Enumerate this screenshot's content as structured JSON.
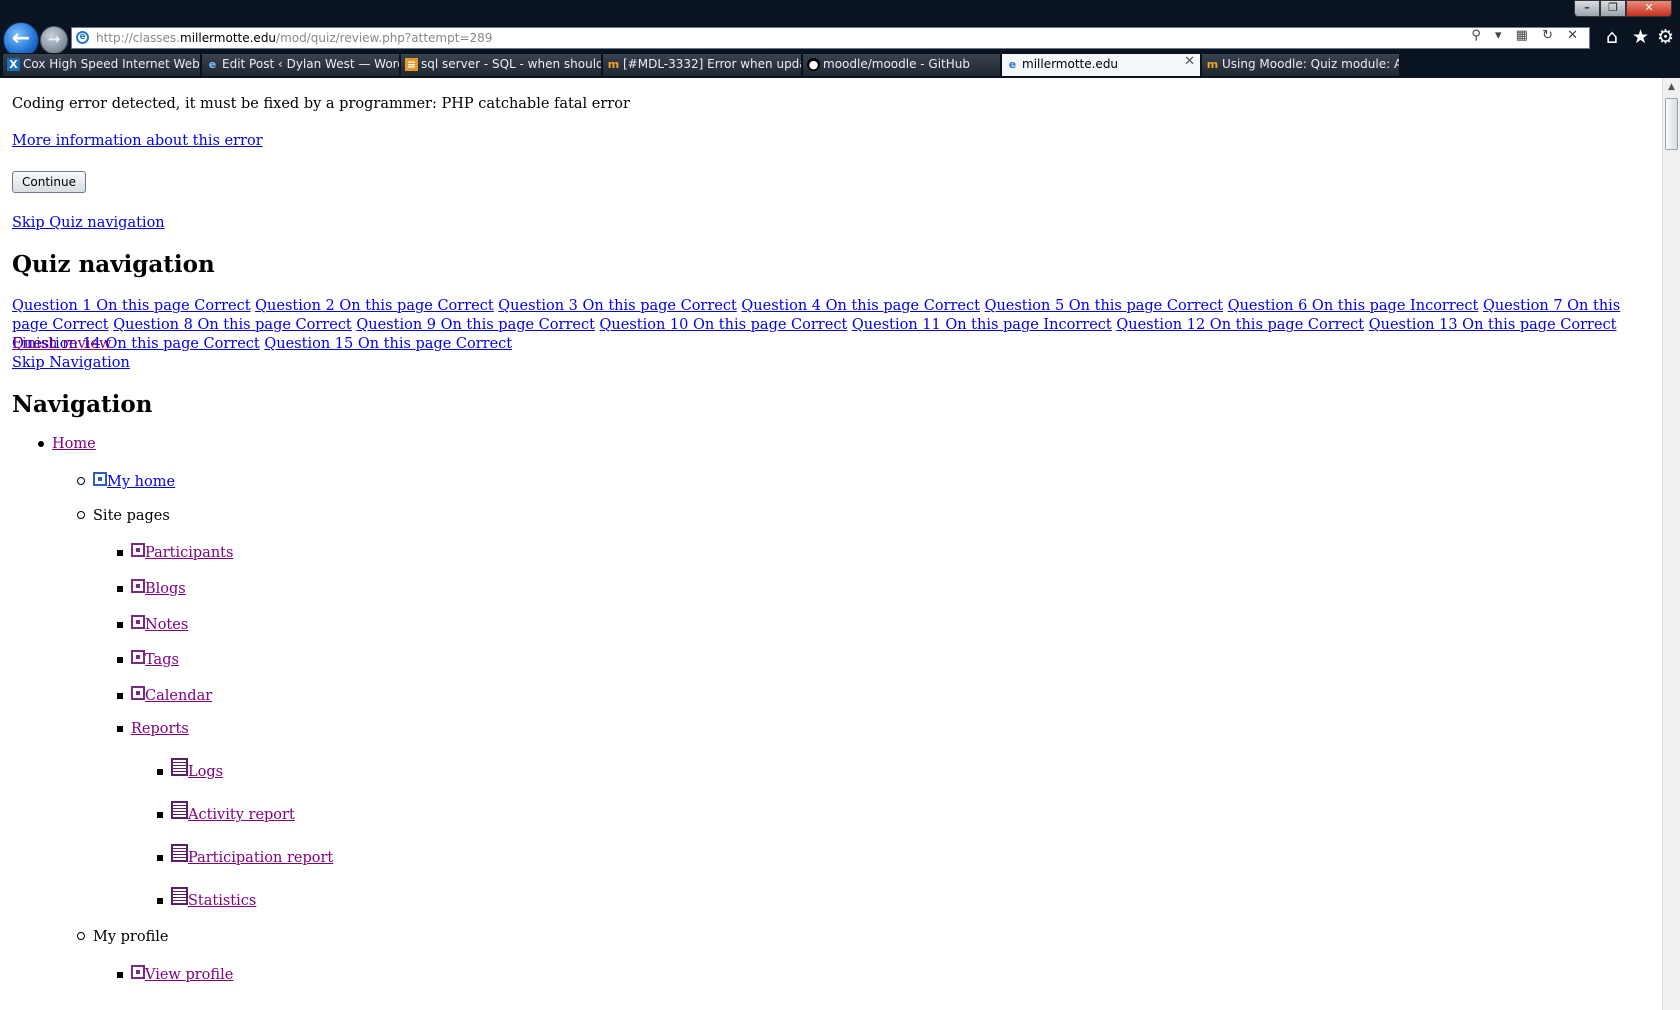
{
  "browser": {
    "url_prefix": "http://classes.",
    "url_domain": "millermotte.edu",
    "url_path": "/mod/quiz/review.php?attempt=289",
    "tools_text": "⚲ ▾ ▦ ↻ ✕",
    "back_glyph": "←",
    "forward_glyph": "→",
    "address_icon": "e",
    "home_glyph": "⌂",
    "fav_glyph": "★",
    "gear_glyph": "⚙",
    "window": {
      "min": "–",
      "max": "❐",
      "close": "✕"
    },
    "tabs": [
      {
        "label": "Cox High Speed Internet Web...",
        "icon": "X"
      },
      {
        "label": "Edit Post ‹ Dylan West — Word...",
        "icon": "e"
      },
      {
        "label": "sql server - SQL - when should ...",
        "icon": "≡"
      },
      {
        "label": "[#MDL-3332] Error when updat...",
        "icon": "m"
      },
      {
        "label": "moodle/moodle - GitHub",
        "icon": "●"
      },
      {
        "label": "millermotte.edu",
        "icon": "e",
        "close": "✕"
      },
      {
        "label": "Using Moodle: Quiz module: A...",
        "icon": "m"
      }
    ]
  },
  "page": {
    "error_message": "Coding error detected, it must be fixed by a programmer: PHP catchable fatal error",
    "more_info_link": "More information about this error",
    "continue_button": "Continue",
    "skip_quiz_nav": "Skip Quiz navigation",
    "quiz_nav_heading": "Quiz navigation",
    "questions": [
      {
        "label": "Question 1 On this page Correct"
      },
      {
        "label": "Question 2 On this page Correct"
      },
      {
        "label": "Question 3 On this page Correct"
      },
      {
        "label": "Question 4 On this page Correct"
      },
      {
        "label": "Question 5 On this page Correct"
      },
      {
        "label": "Question 6 On this page Incorrect"
      },
      {
        "label": "Question 7 On this page Correct"
      },
      {
        "label": "Question 8 On this page Correct"
      },
      {
        "label": "Question 9 On this page Correct"
      },
      {
        "label": "Question 10 On this page Correct"
      },
      {
        "label": "Question 11 On this page Incorrect"
      },
      {
        "label": "Question 12 On this page Correct"
      },
      {
        "label": "Question 13 On this page Correct"
      },
      {
        "label": "Question 14 On this page Correct"
      },
      {
        "label": "Question 15 On this page Correct"
      }
    ],
    "finish_review": "Finish review",
    "skip_navigation": "Skip Navigation",
    "nav_heading": "Navigation",
    "nav": {
      "home": "Home",
      "my_home": "My home",
      "site_pages": "Site pages",
      "participants": "Participants",
      "blogs": "Blogs",
      "notes": "Notes",
      "tags": "Tags",
      "calendar": "Calendar",
      "reports": "Reports",
      "logs": "Logs",
      "activity_report": "Activity report",
      "participation_report": "Participation report",
      "statistics": "Statistics",
      "my_profile": "My profile",
      "view_profile": "View profile"
    }
  },
  "scrollbar": {
    "up_glyph": "▲"
  }
}
